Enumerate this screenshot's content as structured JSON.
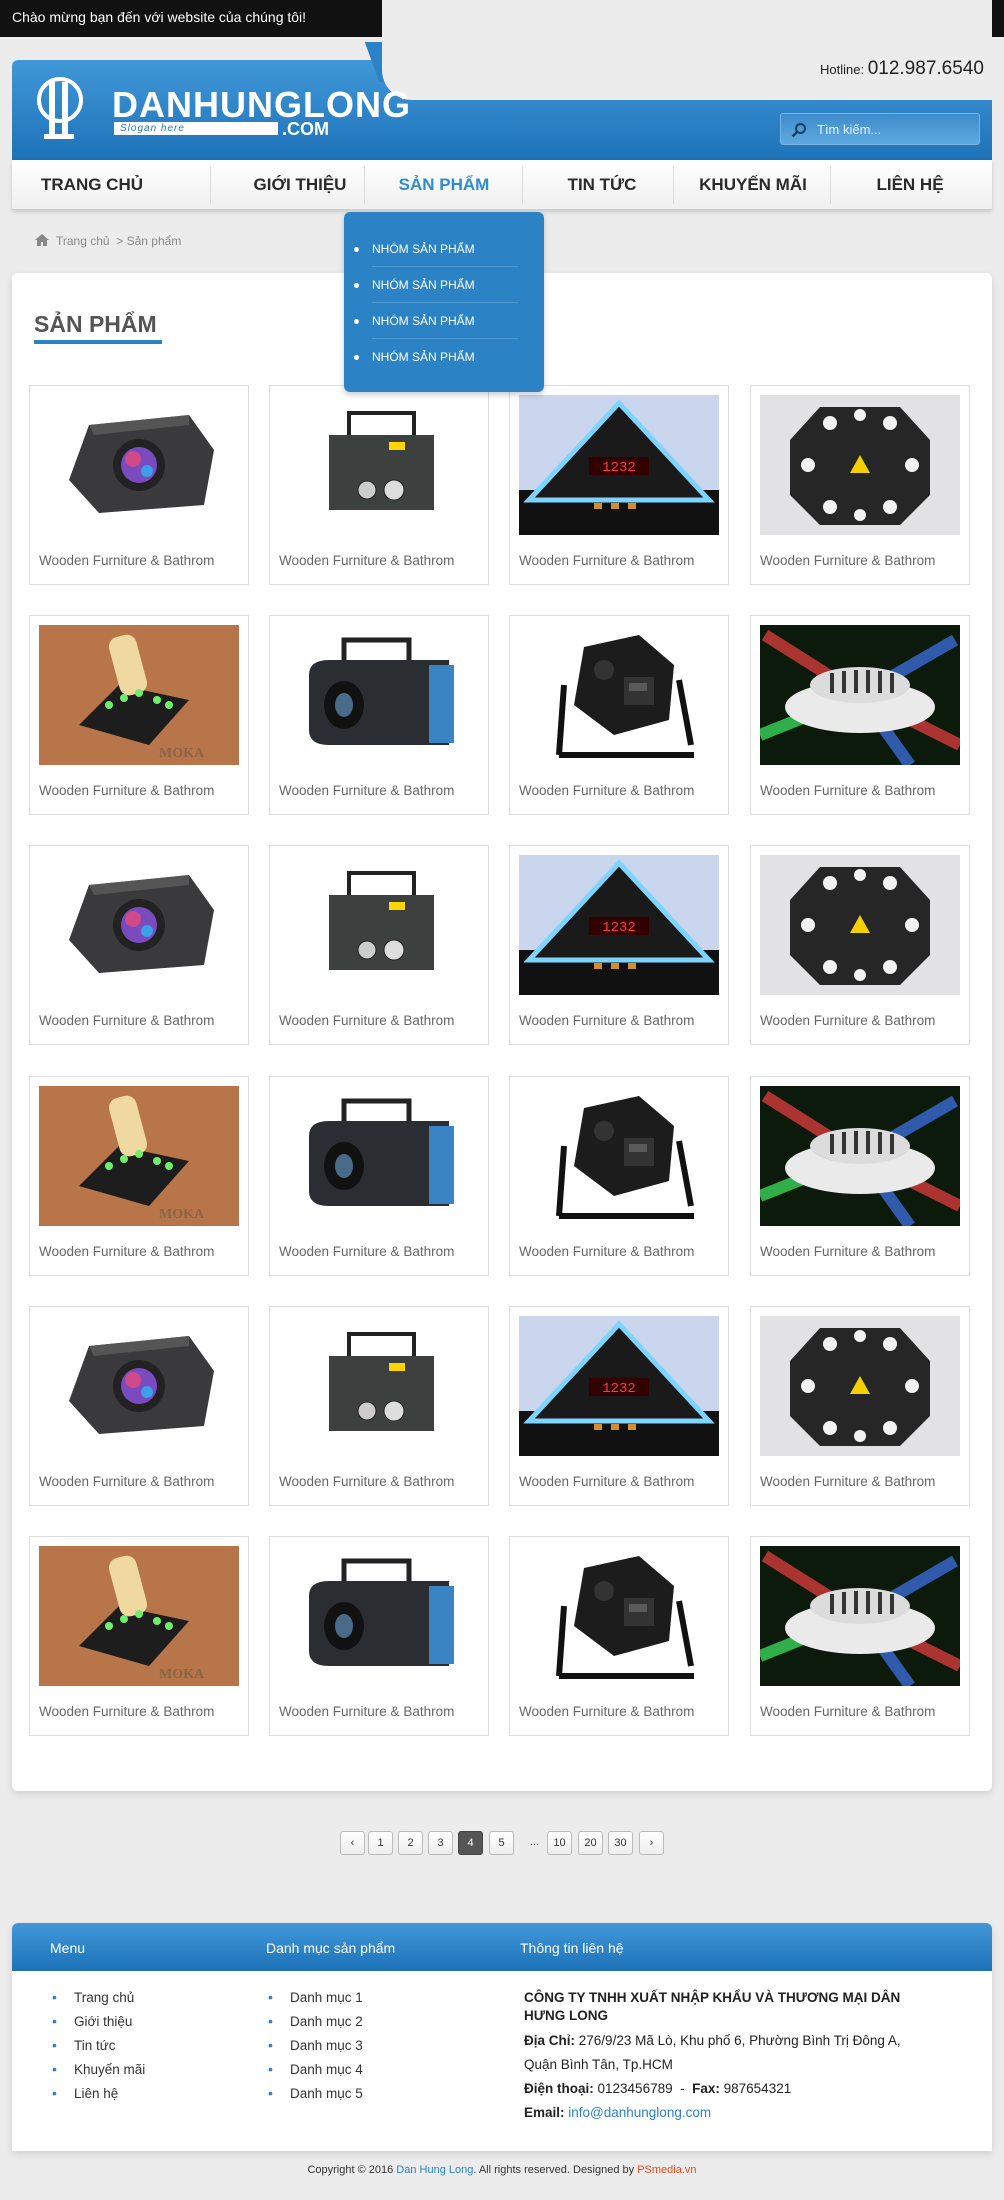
{
  "topbar": {
    "welcome": "Chào mừng bạn đến với website của chúng tôi!",
    "social": [
      "facebook-icon",
      "twitter-icon",
      "google-plus-icon"
    ]
  },
  "header": {
    "logo_name": "DANHUNGLONG",
    "logo_slogan": "Slogan here",
    "logo_domain": ".COM",
    "hotline_label": "Hotline:",
    "hotline_number": "012.987.6540",
    "search_placeholder": "Tìm kiếm..."
  },
  "nav": {
    "items": [
      "TRANG CHỦ",
      "GIỚI THIỆU",
      "SẢN PHẨM",
      "TIN TỨC",
      "KHUYẾN MÃI",
      "LIÊN HỆ"
    ],
    "active": "SẢN PHẨM"
  },
  "dropdown": [
    "NHÓM SẢN PHẨM",
    "NHÓM SẢN PHẨM",
    "NHÓM SẢN PHẨM",
    "NHÓM SẢN PHẨM"
  ],
  "breadcrumb": {
    "home": "Trang chủ",
    "current": "> Sản phẩm"
  },
  "section_title": "SẢN PHẨM",
  "products": [
    {
      "name": "Wooden Furniture & Bathrom",
      "image": "dj-light-octagon"
    },
    {
      "name": "Wooden Furniture & Bathrom",
      "image": "laser-projector"
    },
    {
      "name": "Wooden Furniture & Bathrom",
      "image": "pyramid-clock"
    },
    {
      "name": "Wooden Furniture & Bathrom",
      "image": "gobo-light"
    },
    {
      "name": "Wooden Furniture & Bathrom",
      "image": "co2-jet"
    },
    {
      "name": "Wooden Furniture & Bathrom",
      "image": "fog-machine"
    },
    {
      "name": "Wooden Furniture & Bathrom",
      "image": "par-light"
    },
    {
      "name": "Wooden Furniture & Bathrom",
      "image": "ufo-led"
    }
  ],
  "pagination": [
    "‹",
    "1",
    "2",
    "3",
    "4",
    "5",
    "...",
    "10",
    "20",
    "30",
    "›"
  ],
  "pagination_active": "4",
  "footer": {
    "headers": [
      "Menu",
      "Danh mục sản phẩm",
      "Thông tin liên hệ"
    ],
    "menu": [
      "Trang chủ",
      "Giới thiệu",
      "Tin tức",
      "Khuyến mãi",
      "Liên hệ"
    ],
    "categories": [
      "Danh mục 1",
      "Danh mục 2",
      "Danh mục 3",
      "Danh mục 4",
      "Danh mục 5"
    ],
    "company_name": "CÔNG TY TNHH XUẤT NHẬP KHẨU VÀ THƯƠNG MẠI DÂN HƯNG LONG",
    "address_label": "Địa Chỉ:",
    "address": "276/9/23 Mã Lò, Khu phố 6, Phường Bình Trị Đông A, Quận Bình Tân, Tp.HCM",
    "phone_label": "Điện thoại:",
    "phone": "0123456789",
    "fax_label": "Fax:",
    "fax": "987654321",
    "email_label": "Email:",
    "email": "info@danhunglong.com"
  },
  "copyright": {
    "prefix": "Copyright © 2016",
    "brand": "Dan Hung Long",
    "middle": ". All rights reserved. Designed by",
    "designer": "PSmedia.vn"
  },
  "colors": {
    "accent": "#2b82c4",
    "topbar": "#111111",
    "designer_link": "#e8491d"
  }
}
